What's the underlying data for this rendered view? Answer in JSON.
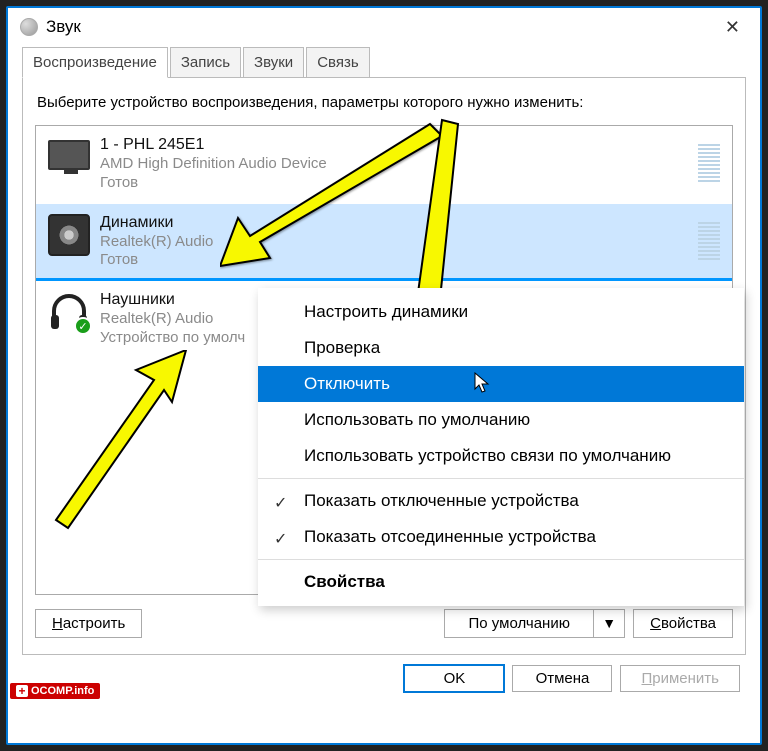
{
  "titlebar": {
    "title": "Звук"
  },
  "tabs": [
    {
      "label": "Воспроизведение",
      "active": true
    },
    {
      "label": "Запись"
    },
    {
      "label": "Звуки"
    },
    {
      "label": "Связь"
    }
  ],
  "instruction": "Выберите устройство воспроизведения, параметры которого нужно изменить:",
  "devices": [
    {
      "name": "1 - PHL 245E1",
      "sub": "AMD High Definition Audio Device",
      "status": "Готов",
      "icon": "monitor",
      "selected": false,
      "default": false
    },
    {
      "name": "Динамики",
      "sub": "Realtek(R) Audio",
      "status": "Готов",
      "icon": "speaker",
      "selected": true,
      "default": false
    },
    {
      "name": "Наушники",
      "sub": "Realtek(R) Audio",
      "status": "Устройство по умолч",
      "icon": "headphones",
      "selected": false,
      "default": true
    }
  ],
  "context_menu": {
    "items": [
      {
        "label": "Настроить динамики",
        "type": "item"
      },
      {
        "label": "Проверка",
        "type": "item"
      },
      {
        "label": "Отключить",
        "type": "item",
        "hover": true
      },
      {
        "label": "Использовать по умолчанию",
        "type": "item"
      },
      {
        "label": "Использовать устройство связи по умолчанию",
        "type": "item"
      },
      {
        "type": "sep"
      },
      {
        "label": "Показать отключенные устройства",
        "type": "item",
        "checked": true
      },
      {
        "label": "Показать отсоединенные устройства",
        "type": "item",
        "checked": true
      },
      {
        "type": "sep"
      },
      {
        "label": "Свойства",
        "type": "item",
        "bold": true
      }
    ]
  },
  "buttons": {
    "configure": "Настроить",
    "set_default": "По умолчанию",
    "properties": "Свойства",
    "ok": "OK",
    "cancel": "Отмена",
    "apply": "Применить"
  },
  "watermark": "OCOMP.info"
}
